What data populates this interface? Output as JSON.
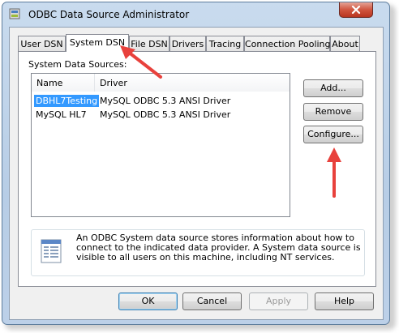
{
  "window": {
    "title": "ODBC Data Source Administrator"
  },
  "tabs": [
    {
      "label": "User DSN"
    },
    {
      "label": "System DSN",
      "active": true
    },
    {
      "label": "File DSN"
    },
    {
      "label": "Drivers"
    },
    {
      "label": "Tracing"
    },
    {
      "label": "Connection Pooling"
    },
    {
      "label": "About"
    }
  ],
  "system_dsn": {
    "section_label": "System Data Sources:",
    "columns": {
      "name": "Name",
      "driver": "Driver"
    },
    "rows": [
      {
        "name": "DBHL7Testing",
        "driver": "MySQL ODBC 5.3 ANSI Driver",
        "selected": true
      },
      {
        "name": "MySQL HL7",
        "driver": "MySQL ODBC 5.3 ANSI Driver"
      }
    ],
    "buttons": {
      "add": "Add...",
      "remove": "Remove",
      "configure": "Configure..."
    },
    "info_text": "An ODBC System data source stores information about how to connect to the indicated data provider.   A System data source is visible to all users on this machine, including NT services."
  },
  "footer": {
    "ok": "OK",
    "cancel": "Cancel",
    "apply": "Apply",
    "help": "Help"
  },
  "icons": [
    "odbc-app-icon",
    "close-icon",
    "info-document-icon",
    "annotation-arrow"
  ],
  "colors": {
    "annotation_arrow": "#e8413c",
    "selection": "#3399ff",
    "close_button": "#c9432d"
  }
}
